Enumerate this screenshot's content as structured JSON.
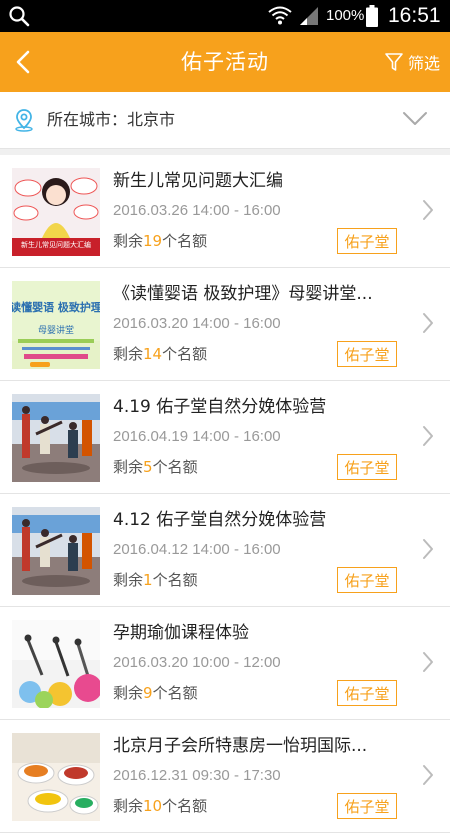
{
  "status_bar": {
    "battery_percent": "100%",
    "time": "16:51"
  },
  "header": {
    "title": "佑子活动",
    "filter_label": "筛选",
    "accent_color": "#f7a11c"
  },
  "city_bar": {
    "label": "所在城市：北京市"
  },
  "remain_prefix": "剩余",
  "remain_suffix": "个名额",
  "events": [
    {
      "title": "新生儿常见问题大汇编",
      "time": "2016.03.26 14:00 - 16:00",
      "remaining": "19",
      "tag": "佑子堂",
      "thumb_type": "qa-poster",
      "poster_heading": "新生儿常见问题大汇编"
    },
    {
      "title": "《读懂婴语 极致护理》母婴讲堂...",
      "time": "2016.03.20 14:00 - 16:00",
      "remaining": "14",
      "tag": "佑子堂",
      "thumb_type": "text-poster",
      "poster_heading": "读懂婴语 极致护理",
      "poster_sub": "母婴讲堂"
    },
    {
      "title": "4.19 佑子堂自然分娩体验营",
      "time": "2016.04.19 14:00 - 16:00",
      "remaining": "5",
      "tag": "佑子堂",
      "thumb_type": "yoga-room"
    },
    {
      "title": "4.12 佑子堂自然分娩体验营",
      "time": "2016.04.12 14:00 - 16:00",
      "remaining": "1",
      "tag": "佑子堂",
      "thumb_type": "yoga-room"
    },
    {
      "title": "孕期瑜伽课程体验",
      "time": "2016.03.20 10:00 - 12:00",
      "remaining": "9",
      "tag": "佑子堂",
      "thumb_type": "yoga-balls"
    },
    {
      "title": "北京月子会所特惠房一怡玥国际...",
      "time": "2016.12.31 09:30 - 17:30",
      "remaining": "10",
      "tag": "佑子堂",
      "thumb_type": "food-dishes"
    }
  ]
}
